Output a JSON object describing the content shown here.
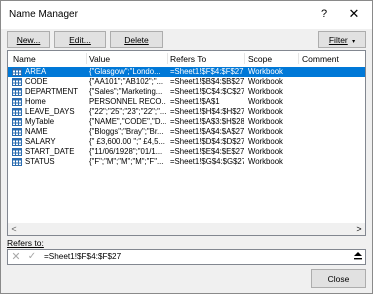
{
  "window": {
    "title": "Name Manager",
    "help": "?",
    "close": "✕"
  },
  "toolbar": {
    "new_label": "New...",
    "edit_label": "Edit...",
    "delete_label": "Delete",
    "filter_label": "Filter"
  },
  "columns": [
    "Name",
    "Value",
    "Refers To",
    "Scope",
    "Comment"
  ],
  "names": [
    {
      "name": "AREA",
      "value": "{\"Glasgow\";\"Londo...",
      "refers_to": "=Sheet1!$F$4:$F$27",
      "scope": "Workbook",
      "comment": "",
      "selected": true
    },
    {
      "name": "CODE",
      "value": "{\"AA101\";\"AB102\";\"...",
      "refers_to": "=Sheet1!$B$4:$B$27",
      "scope": "Workbook",
      "comment": ""
    },
    {
      "name": "DEPARTMENT",
      "value": "{\"Sales\";\"Marketing...",
      "refers_to": "=Sheet1!$C$4:$C$27",
      "scope": "Workbook",
      "comment": ""
    },
    {
      "name": "Home",
      "value": "PERSONNEL RECO...",
      "refers_to": "=Sheet1!$A$1",
      "scope": "Workbook",
      "comment": ""
    },
    {
      "name": "LEAVE_DAYS",
      "value": "{\"22\";\"25\";\"23\";\"22\";\"...",
      "refers_to": "=Sheet1!$H$4:$H$27",
      "scope": "Workbook",
      "comment": ""
    },
    {
      "name": "MyTable",
      "value": "{\"NAME\",\"CODE\",\"D...",
      "refers_to": "=Sheet1!$A$3:$H$28",
      "scope": "Workbook",
      "comment": ""
    },
    {
      "name": "NAME",
      "value": "{\"Bloggs\";\"Bray\";\"Br...",
      "refers_to": "=Sheet1!$A$4:$A$27",
      "scope": "Workbook",
      "comment": ""
    },
    {
      "name": "SALARY",
      "value": "{\" £3,600.00 \";\" £4,5...",
      "refers_to": "=Sheet1!$D$4:$D$27",
      "scope": "Workbook",
      "comment": ""
    },
    {
      "name": "START_DATE",
      "value": "{\"11/06/1928\";\"01/1...",
      "refers_to": "=Sheet1!$E$4:$E$27",
      "scope": "Workbook",
      "comment": ""
    },
    {
      "name": "STATUS",
      "value": "{\"F\";\"M\";\"M\";\"M\";\"F\"...",
      "refers_to": "=Sheet1!$G$4:$G$27",
      "scope": "Workbook",
      "comment": ""
    }
  ],
  "refers_to_label": "Refers to:",
  "refers_to_value": "=Sheet1!$F$4:$F$27",
  "close_label": "Close",
  "colors": {
    "selection": "#0078d7",
    "icon_blue": "#2b6cb0"
  },
  "icons": {
    "name_item": "table-icon",
    "scroll_left": "chevron-left-icon",
    "scroll_right": "chevron-right-icon",
    "cancel": "cancel-x-icon",
    "confirm": "checkmark-icon",
    "collapse": "collapse-dialog-icon",
    "filter_dropdown": "dropdown-arrow-icon"
  }
}
